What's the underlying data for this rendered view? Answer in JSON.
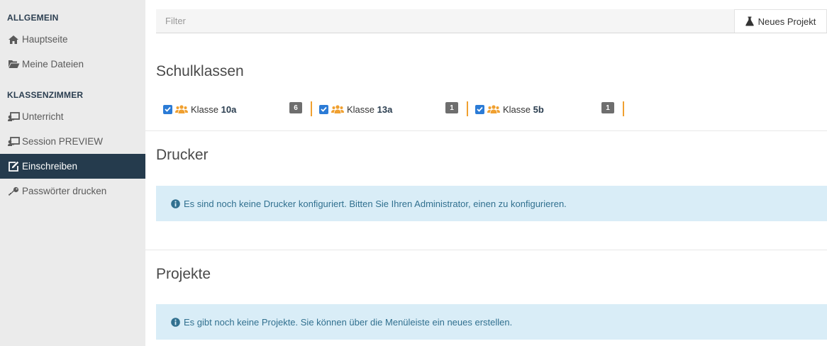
{
  "sidebar": {
    "sections": [
      {
        "heading": "ALLGEMEIN",
        "items": [
          {
            "label": "Hauptseite",
            "icon": "home-icon"
          },
          {
            "label": "Meine Dateien",
            "icon": "folder-open-icon"
          }
        ]
      },
      {
        "heading": "KLASSENZIMMER",
        "items": [
          {
            "label": "Unterricht",
            "icon": "chalkboard-teacher-icon"
          },
          {
            "label": "Session PREVIEW",
            "icon": "chalkboard-teacher-icon"
          },
          {
            "label": "Einschreiben",
            "icon": "edit-icon",
            "active": true
          },
          {
            "label": "Passwörter drucken",
            "icon": "key-icon"
          }
        ]
      }
    ]
  },
  "toolbar": {
    "filter_placeholder": "Filter",
    "new_project_label": "Neues Projekt"
  },
  "schulklassen": {
    "title": "Schulklassen",
    "classes": [
      {
        "prefix": "Klasse",
        "name": "10a",
        "count": "6",
        "checked": true
      },
      {
        "prefix": "Klasse",
        "name": "13a",
        "count": "1",
        "checked": true
      },
      {
        "prefix": "Klasse",
        "name": "5b",
        "count": "1",
        "checked": true
      }
    ]
  },
  "drucker": {
    "title": "Drucker",
    "message": "Es sind noch keine Drucker konfiguriert. Bitten Sie Ihren Administrator, einen zu konfigurieren."
  },
  "projekte": {
    "title": "Projekte",
    "message": "Es gibt noch keine Projekte. Sie können über die Menüleiste ein neues erstellen."
  },
  "colors": {
    "sidebar_bg": "#ebebeb",
    "active_item_bg": "#253b4d",
    "accent_orange": "#f0a030",
    "checkbox_blue": "#2b7bd6",
    "info_bg": "#d9edf7",
    "info_text": "#31708f"
  }
}
